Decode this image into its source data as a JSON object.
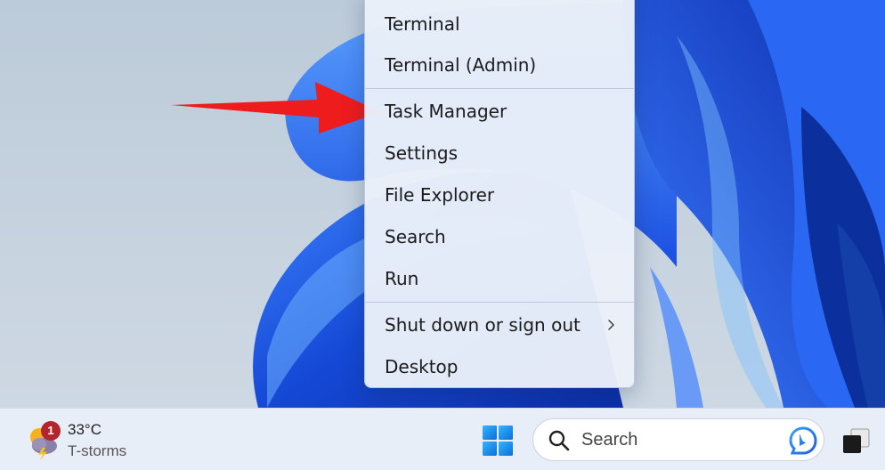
{
  "context_menu": {
    "items": [
      {
        "label": "Terminal"
      },
      {
        "label": "Terminal (Admin)"
      },
      {
        "label": "Task Manager"
      },
      {
        "label": "Settings"
      },
      {
        "label": "File Explorer"
      },
      {
        "label": "Search"
      },
      {
        "label": "Run"
      },
      {
        "label": "Shut down or sign out",
        "has_submenu": true,
        "submenu_icon": "chevron-right-icon"
      },
      {
        "label": "Desktop"
      }
    ]
  },
  "annotation": {
    "arrow_color": "#ee1c1c",
    "points_to": "Task Manager"
  },
  "taskbar": {
    "weather": {
      "temperature": "33°C",
      "condition": "T-storms",
      "badge_count": "1",
      "icon": "thunderstorm-icon"
    },
    "start_icon": "windows-start-icon",
    "search": {
      "placeholder": "Search",
      "icon": "search-icon",
      "right_icon": "bing-icon"
    },
    "task_view_icon": "task-view-icon"
  },
  "colors": {
    "accent": "#0067c0",
    "wallpaper_blue": "#1f5fe8",
    "menu_background": "#eaf0f9",
    "taskbar_background": "#e8eef7"
  }
}
